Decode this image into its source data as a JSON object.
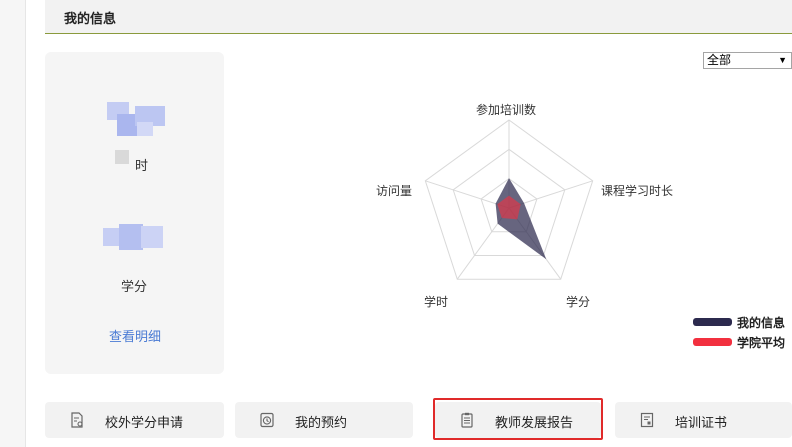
{
  "section": {
    "title": "我的信息"
  },
  "scope_select": {
    "value": "全部"
  },
  "stats": {
    "hours_label": "学时",
    "hours_label_visible": "时",
    "credits_label": "学分",
    "detail_link": "查看明细"
  },
  "radar": {
    "axes": [
      "参加培训数",
      "课程学习时长",
      "学分",
      "学时",
      "访问量"
    ],
    "levels": 3,
    "colors": {
      "mine": "#2c2a4e",
      "avg": "#f2303f",
      "grid": "#d9d9d9"
    }
  },
  "chart_data": {
    "type": "radar",
    "axes": [
      "参加培训数",
      "课程学习时长",
      "学分",
      "学时",
      "访问量"
    ],
    "range": [
      0,
      1
    ],
    "series": [
      {
        "name": "我的信息",
        "values": [
          0.34,
          0.18,
          0.72,
          0.22,
          0.16
        ],
        "color": "#2c2a4e"
      },
      {
        "name": "学院平均",
        "values": [
          0.14,
          0.14,
          0.16,
          0.14,
          0.14
        ],
        "color": "#f2303f"
      }
    ],
    "legend": "bottom-right"
  },
  "legend": [
    {
      "label": "我的信息",
      "color": "#2c2a4e"
    },
    {
      "label": "学院平均",
      "color": "#f2303f"
    }
  ],
  "actions": [
    {
      "label": "校外学分申请",
      "icon": "document-credit-icon"
    },
    {
      "label": "我的预约",
      "icon": "clock-icon"
    },
    {
      "label": "教师发展报告",
      "icon": "clipboard-report-icon",
      "highlighted": true
    },
    {
      "label": "培训证书",
      "icon": "certificate-icon"
    }
  ]
}
